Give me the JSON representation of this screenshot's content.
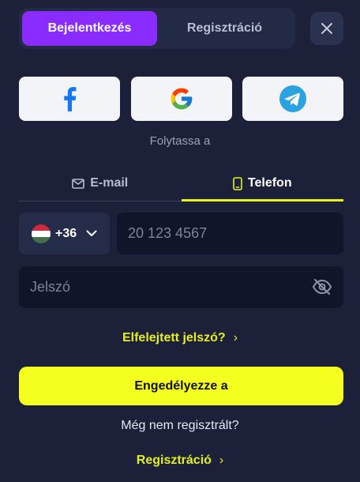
{
  "auth_tabs": {
    "login": "Bejelentkezés",
    "register": "Regisztráció"
  },
  "social": {
    "icons": [
      "facebook-icon",
      "google-icon",
      "telegram-icon"
    ],
    "continue_text": "Folytassa a"
  },
  "mode_tabs": {
    "email": "E-mail",
    "phone": "Telefon",
    "active": "phone"
  },
  "phone": {
    "country_code": "+36",
    "placeholder": "20 123 4567"
  },
  "password": {
    "placeholder": "Jelszó"
  },
  "forgot_link": "Elfelejtett jelszó?",
  "submit_label": "Engedélyezze a",
  "no_account_text": "Még nem regisztrált?",
  "register_link": "Regisztráció",
  "colors": {
    "accent_purple": "#8a2bff",
    "accent_yellow": "#f5ff1f",
    "background": "#1c2139"
  }
}
